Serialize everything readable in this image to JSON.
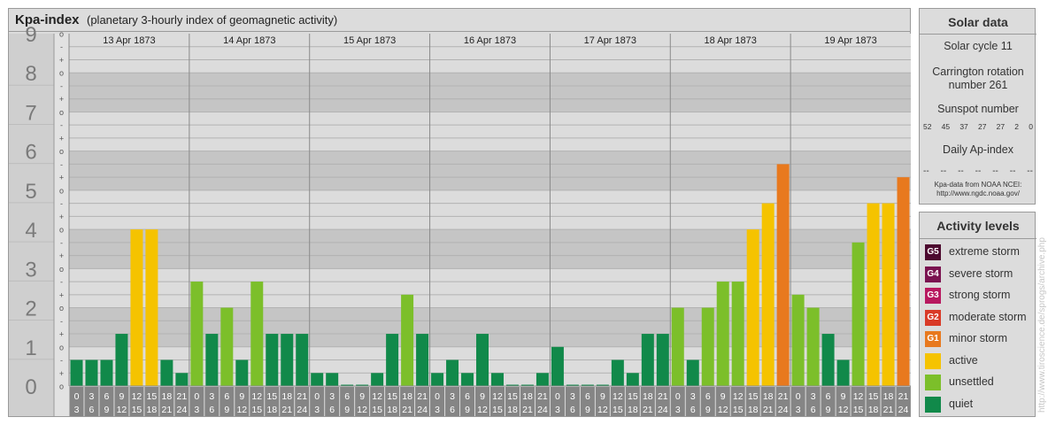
{
  "header": {
    "title": "Kpa-index",
    "subtitle": "(planetary 3-hourly index of geomagnetic activity)"
  },
  "solar": {
    "title": "Solar data",
    "cycle": "Solar cycle 11",
    "carrington_line1": "Carrington rotation",
    "carrington_line2": "number 261",
    "sunspot_title": "Sunspot number",
    "sunspot_values": [
      "52",
      "45",
      "37",
      "27",
      "27",
      "2",
      "0"
    ],
    "ap_title": "Daily Ap-index",
    "ap_values": [
      "--",
      "--",
      "--",
      "--",
      "--",
      "--",
      "--"
    ],
    "source_line1": "Kpa-data from NOAA NCEI:",
    "source_line2": "http://www.ngdc.noaa.gov/"
  },
  "legend": {
    "title": "Activity levels",
    "items": [
      {
        "code": "G5",
        "label": "extreme storm",
        "color": "#4d0a2f"
      },
      {
        "code": "G4",
        "label": "severe storm",
        "color": "#7a1350"
      },
      {
        "code": "G3",
        "label": "strong storm",
        "color": "#b8185f"
      },
      {
        "code": "G2",
        "label": "moderate storm",
        "color": "#d93a27"
      },
      {
        "code": "G1",
        "label": "minor storm",
        "color": "#e8791e"
      },
      {
        "code": "",
        "label": "active",
        "color": "#f5c300"
      },
      {
        "code": "",
        "label": "unsettled",
        "color": "#7cbf2a"
      },
      {
        "code": "",
        "label": "quiet",
        "color": "#11894a"
      }
    ]
  },
  "watermark": "http://www.tiroscience.de/sprogs/archive.php",
  "chart_data": {
    "type": "bar",
    "title": "Kpa-index",
    "subtitle": "(planetary 3-hourly index of geomagnetic activity)",
    "ylim": [
      0,
      9
    ],
    "y_major_ticks": [
      "0",
      "1",
      "2",
      "3",
      "4",
      "5",
      "6",
      "7",
      "8",
      "9"
    ],
    "y_minor_ticks": [
      "o",
      "+",
      "-"
    ],
    "days": [
      "13 Apr 1873",
      "14 Apr 1873",
      "15 Apr 1873",
      "16 Apr 1873",
      "17 Apr 1873",
      "18 Apr 1873",
      "19 Apr 1873"
    ],
    "interval_starts": [
      "0",
      "3",
      "6",
      "9",
      "12",
      "15",
      "18",
      "21"
    ],
    "interval_ends": [
      "3",
      "6",
      "9",
      "12",
      "15",
      "18",
      "21",
      "24"
    ],
    "series": [
      {
        "values": [
          0.667,
          0.667,
          0.667,
          1.333,
          4.0,
          4.0,
          0.667,
          0.333,
          2.667,
          1.333,
          2.0,
          0.667,
          2.667,
          1.333,
          1.333,
          1.333,
          0.333,
          0.333,
          0.0,
          0.0,
          0.333,
          1.333,
          2.333,
          1.333,
          0.333,
          0.667,
          0.333,
          1.333,
          0.333,
          0.0,
          0.0,
          0.333,
          1.0,
          0.0,
          0.0,
          0.0,
          0.667,
          0.333,
          1.333,
          1.333,
          2.0,
          0.667,
          2.0,
          2.667,
          2.667,
          4.0,
          4.667,
          5.667,
          2.333,
          2.0,
          1.333,
          0.667,
          3.667,
          4.667,
          4.667,
          5.333
        ]
      }
    ]
  }
}
